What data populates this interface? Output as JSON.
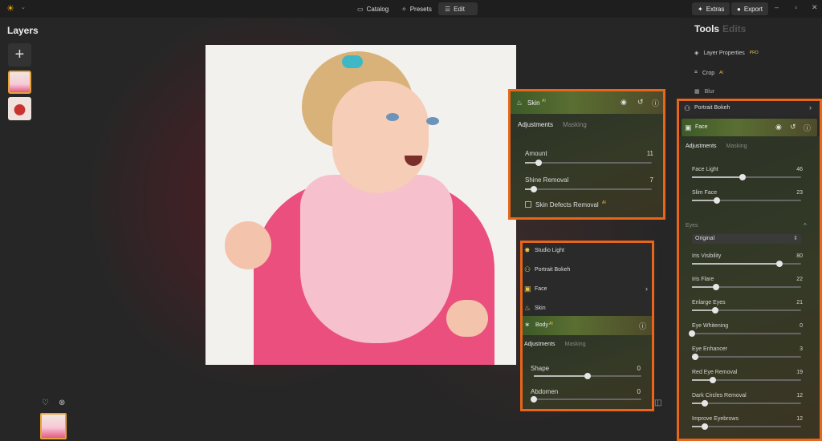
{
  "topbar": {
    "nav": [
      {
        "label": "Catalog",
        "icon": "folder-icon"
      },
      {
        "label": "Presets",
        "icon": "sparkle-icon"
      },
      {
        "label": "Edit",
        "icon": "sliders-icon"
      }
    ],
    "extras": "Extras",
    "export": "Export"
  },
  "layers": {
    "title": "Layers"
  },
  "tools_panel": {
    "tabs": [
      "Tools",
      "Edits"
    ],
    "items": [
      "Layer Properties",
      "Crop",
      "Blur",
      "Portrait Bokeh"
    ],
    "ai_badge": "AI",
    "pro_badge": "PRO"
  },
  "skin_panel": {
    "title": "Skin",
    "badge": "AI",
    "tabs": [
      "Adjustments",
      "Masking"
    ],
    "sliders": [
      {
        "label": "Amount",
        "value": "11",
        "fraction": 0.11
      },
      {
        "label": "Shine Removal",
        "value": "7",
        "fraction": 0.07
      }
    ],
    "checkbox": "Skin Defects Removal"
  },
  "list_panel": {
    "items": [
      "Studio Light",
      "Portrait Bokeh",
      "Face",
      "Skin"
    ],
    "active": "Body",
    "tabs": [
      "Adjustments",
      "Masking"
    ],
    "sliders": [
      {
        "label": "Shape",
        "value": "0",
        "fraction": 0.5
      },
      {
        "label": "Abdomen",
        "value": "0",
        "fraction": 0.0
      }
    ]
  },
  "face_panel": {
    "title": "Face",
    "tabs": [
      "Adjustments",
      "Masking"
    ],
    "sliders": [
      {
        "label": "Face Light",
        "value": "46",
        "fraction": 0.46
      },
      {
        "label": "Slim Face",
        "value": "23",
        "fraction": 0.23
      }
    ],
    "eyes_section": "Eyes",
    "dropdown": "Original",
    "eye_sliders": [
      {
        "label": "Iris Visibility",
        "value": "80",
        "fraction": 0.8
      },
      {
        "label": "Iris Flare",
        "value": "22",
        "fraction": 0.22
      },
      {
        "label": "Enlarge Eyes",
        "value": "21",
        "fraction": 0.21
      },
      {
        "label": "Eye Whitening",
        "value": "0",
        "fraction": 0.0
      },
      {
        "label": "Eye Enhancer",
        "value": "3",
        "fraction": 0.03
      },
      {
        "label": "Red Eye Removal",
        "value": "19",
        "fraction": 0.19
      },
      {
        "label": "Dark Circles Removal",
        "value": "12",
        "fraction": 0.12
      },
      {
        "label": "Improve Eyebrows",
        "value": "12",
        "fraction": 0.12
      }
    ]
  }
}
